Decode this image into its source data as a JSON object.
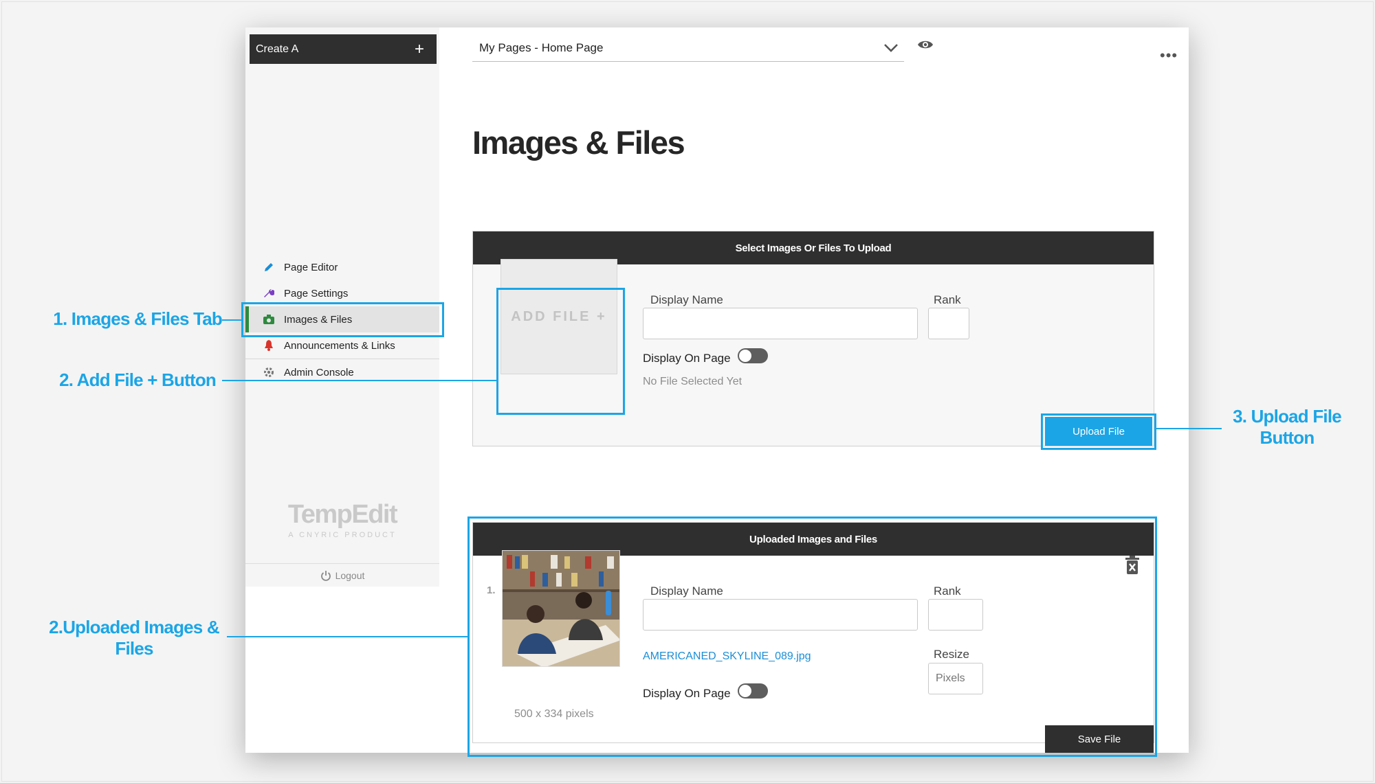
{
  "sidebar": {
    "create_label": "Create A",
    "create_plus": "+",
    "items": [
      {
        "label": "Page Editor",
        "icon": "pencil-icon"
      },
      {
        "label": "Page Settings",
        "icon": "wrench-icon"
      },
      {
        "label": "Images & Files",
        "icon": "camera-icon"
      },
      {
        "label": "Announcements & Links",
        "icon": "bell-icon"
      },
      {
        "label": "Admin Console",
        "icon": "gear-icon"
      }
    ],
    "brand_name": "TempEdit",
    "brand_tagline": "A CNYRIC PRODUCT",
    "logout_label": "Logout"
  },
  "topbar": {
    "page_select_value": "My Pages - Home Page"
  },
  "main": {
    "title": "Images & Files",
    "upload_section": {
      "header": "Select Images Or Files To Upload",
      "add_file_label": "ADD FILE +",
      "display_name_label": "Display Name",
      "rank_label": "Rank",
      "display_on_page_label": "Display On Page",
      "no_file_text": "No File Selected Yet",
      "upload_button": "Upload File"
    },
    "uploaded_section": {
      "header": "Uploaded Images and Files",
      "items": [
        {
          "index": "1.",
          "display_name_label": "Display Name",
          "rank_label": "Rank",
          "filename": "AMERICANED_SKYLINE_089.jpg",
          "display_on_page_label": "Display On Page",
          "resize_label": "Resize",
          "resize_placeholder": "Pixels",
          "dimensions": "500 x 334 pixels",
          "save_button": "Save File"
        }
      ]
    }
  },
  "annotations": [
    {
      "label": "1. Images & Files Tab"
    },
    {
      "label": "2. Add File + Button"
    },
    {
      "label": "3. Upload File Button"
    },
    {
      "label": "2.Uploaded Images & Files"
    }
  ],
  "colors": {
    "accent": "#1ba5e6",
    "dark": "#2f2f2f",
    "active_tab": "#2e8a3e"
  }
}
